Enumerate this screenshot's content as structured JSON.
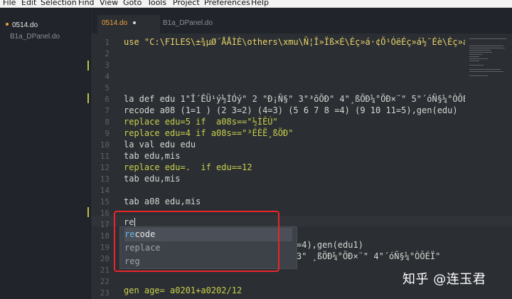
{
  "menu": [
    "File",
    "Edit",
    "Selection",
    "Find",
    "View",
    "Goto",
    "Tools",
    "Project",
    "Preferences",
    "Help"
  ],
  "sidebar": {
    "files": [
      {
        "name": "0514.do",
        "active": true
      },
      {
        "name": "B1a_DPanel.do",
        "active": false
      }
    ]
  },
  "tabs": [
    {
      "name": "0514.do",
      "active": true
    },
    {
      "name": "B1a_DPanel.do",
      "active": false
    }
  ],
  "gutter": {
    "line_numbers": [
      "1",
      "2",
      "3",
      "4",
      "5",
      "6",
      "7",
      "8",
      "9",
      "10",
      "11",
      "12",
      "13",
      "14",
      "15",
      "16",
      "17",
      "18",
      "19",
      "20",
      "21",
      "22",
      "23"
    ]
  },
  "code": {
    "l1": "use \"C:\\FILES\\±¾µØ´ÅÅÌÈ\\others\\xmu\\Ñ¦Î»Ïß×É\\Éç»á·¢Õ¹ÓëÉç»á½¨Éè\\Éç»á·¢",
    "l6": "la def edu 1\"Î´ÊÜ¹ý½ÌÓý\" 2 \"Ð¡Ñ§\" 3\"³õÖÐ\" 4\"¸ßÖÐ¼°ÖÐ×¨\" 5\"´óÑ§¼°ÒÔÉÏ\"",
    "l7": "recode a08 (1=1 ) (2 3=2) (4=3) (5 6 7 8 =4) (9 10 11=5),gen(edu)",
    "l8": "replace edu=5 if  a08s==\"½ÌÊÚ\"",
    "l9": "replace edu=4 if a08s==\"³ÉÈË¸ßÖÐ\"",
    "l10": "la val edu edu",
    "l11": "tab edu,mis",
    "l12": "replace edu=.  if edu==12",
    "l13": "tab edu,mis",
    "l15": "tab a08 edu,mis",
    "l17": "re",
    "l19": "=4),gen(edu1)",
    "l20": "3\" ¸ßÖÐ¼°ÖÐ×¨\" 4\"´óÑ§¼°ÒÔÉÏ\"",
    "l23": "gen age= a0201+a0202/12"
  },
  "autocomplete": {
    "typed": "re",
    "items": [
      {
        "prefix": "re",
        "rest": "code",
        "selected": true
      },
      {
        "prefix": "re",
        "rest": "place",
        "selected": false
      },
      {
        "prefix": "re",
        "rest": "g",
        "selected": false
      }
    ]
  },
  "watermark": "知乎 @连玉君",
  "colors": {
    "keyword": "#c8d14b",
    "string": "#e8d46a",
    "number": "#c490e4",
    "operator": "#f06a6a",
    "function": "#66c2e0",
    "highlight_box": "#e8262a",
    "tab_active": "#f0a13a"
  }
}
